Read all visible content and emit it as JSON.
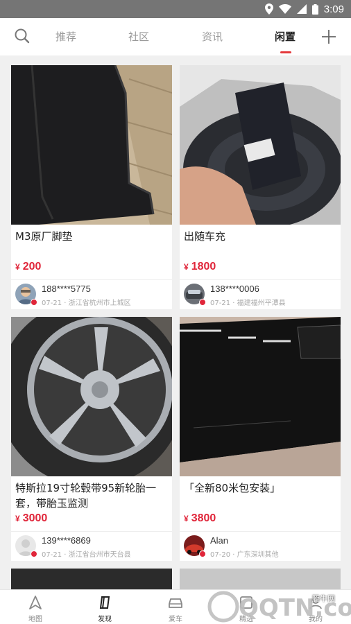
{
  "status_bar": {
    "time": "3:09"
  },
  "nav": {
    "tabs": [
      {
        "label": "推荐"
      },
      {
        "label": "社区"
      },
      {
        "label": "资讯"
      },
      {
        "label": "闲置"
      }
    ],
    "active_tab": "闲置",
    "accent_color": "#e4393c"
  },
  "cards": [
    {
      "title": "M3原厂脚垫",
      "currency": "¥",
      "price": "200",
      "user": "188****5775",
      "date": "07-21",
      "location": "浙江省杭州市上城区"
    },
    {
      "title": "出随车充",
      "currency": "¥",
      "price": "1800",
      "user": "138****0006",
      "date": "07-21",
      "location": "福建福州平潭县"
    },
    {
      "title": "特斯拉19寸轮毂带95新轮胎一套，带胎玉监测",
      "currency": "¥",
      "price": "3000",
      "user": "139****6869",
      "date": "07-21",
      "location": "浙江省台州市天台县"
    },
    {
      "title": "「全新80米包安装」",
      "currency": "¥",
      "price": "3800",
      "user": "Alan",
      "date": "07-20",
      "location": "广东深圳其他"
    }
  ],
  "bottom_nav": {
    "items": [
      {
        "label": "地图",
        "icon": "map-icon"
      },
      {
        "label": "发现",
        "icon": "discover-icon"
      },
      {
        "label": "爱车",
        "icon": "car-icon"
      },
      {
        "label": "精选",
        "icon": "featured-icon"
      },
      {
        "label": "我的",
        "icon": "profile-icon"
      }
    ],
    "active_item": "发现"
  },
  "watermark": {
    "text": "腾牛网",
    "logo": "QQTN.com"
  }
}
